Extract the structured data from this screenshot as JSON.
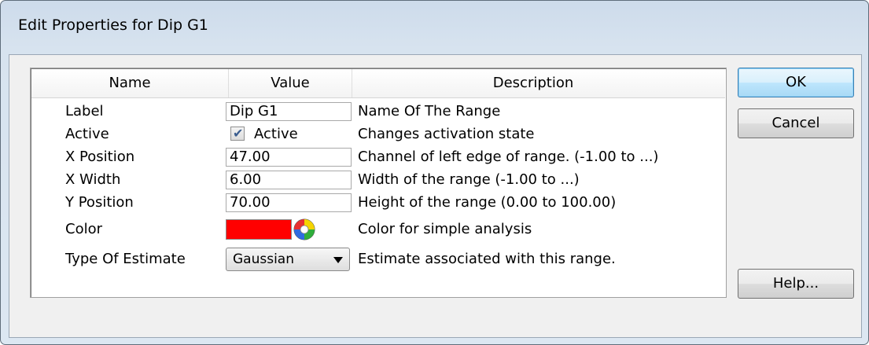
{
  "window": {
    "title": "Edit Properties for Dip G1"
  },
  "grid": {
    "headers": {
      "name": "Name",
      "value": "Value",
      "description": "Description"
    },
    "rows": [
      {
        "label": "Label",
        "value": "Dip G1",
        "description": "Name Of The Range"
      },
      {
        "label": "Active",
        "value": "Active",
        "checked": true,
        "description": "Changes activation state"
      },
      {
        "label": "X Position",
        "value": "47.00",
        "description": "Channel of left edge of range. (-1.00 to ...)"
      },
      {
        "label": "X Width",
        "value": "6.00",
        "description": "Width of the range (-1.00 to ...)"
      },
      {
        "label": "Y Position",
        "value": "70.00",
        "description": "Height of the range (0.00 to 100.00)"
      },
      {
        "label": "Color",
        "value": "#ff0000",
        "description": "Color for simple analysis"
      },
      {
        "label": "Type Of Estimate",
        "value": "Gaussian",
        "description": "Estimate associated with this range."
      }
    ]
  },
  "buttons": {
    "ok": "OK",
    "cancel": "Cancel",
    "help": "Help..."
  },
  "icons": {
    "check": "checkmark-icon",
    "color_picker": "color-wheel-icon",
    "dropdown": "chevron-down-icon"
  }
}
